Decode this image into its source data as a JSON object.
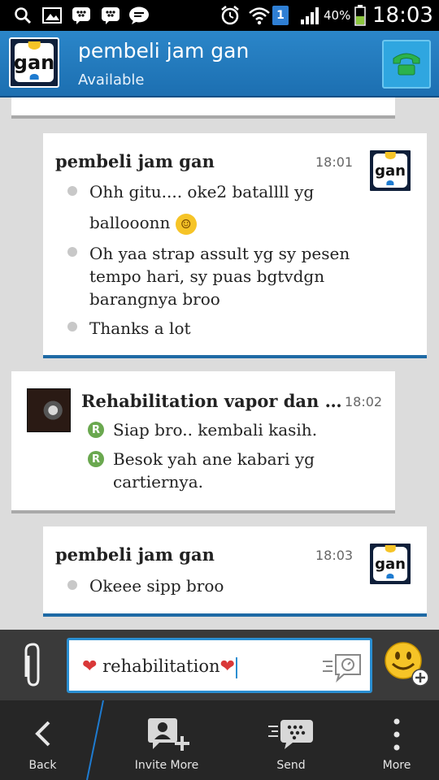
{
  "status_bar": {
    "battery_percent": "40%",
    "time": "18:03",
    "sim_badge": "1",
    "icons": [
      "search-icon",
      "gallery-icon",
      "bbm-icon",
      "bbm-icon",
      "chat-icon",
      "alarm-icon",
      "wifi-icon",
      "signal-icon",
      "battery-icon"
    ]
  },
  "header": {
    "avatar_text": "gan",
    "title": "pembeli jam gan",
    "status": "Available",
    "call_icon": "phone-icon"
  },
  "messages": [
    {
      "sender": "pembeli jam gan",
      "time": "18:01",
      "avatar_text": "gan",
      "lines": [
        {
          "text": "Ohh gitu.... oke2 batallll yg",
          "text2": "ballooonn",
          "emoji": "laughing-emoji"
        },
        {
          "text": "Oh yaa strap assult yg sy pesen tempo hari, sy puas bgtvdgn barangnya broo"
        },
        {
          "text": "Thanks a lot"
        }
      ]
    },
    {
      "sender": "Rehabilitation vapor dan j...",
      "time": "18:02",
      "read_mark": "R",
      "lines": [
        {
          "text": "Siap bro.. kembali kasih."
        },
        {
          "text": "Besok yah ane kabari yg cartiernya."
        }
      ]
    },
    {
      "sender": "pembeli jam gan",
      "time": "18:03",
      "avatar_text": "gan",
      "lines": [
        {
          "text": "Okeee sipp broo"
        }
      ]
    }
  ],
  "composer": {
    "value": "rehabilitation",
    "attach_icon": "paperclip-icon",
    "voice_icon": "voice-note-icon",
    "emoji_icon": "emoji-add-icon"
  },
  "bottom_bar": {
    "back_label": "Back",
    "invite_label": "Invite More",
    "send_label": "Send",
    "more_label": "More"
  },
  "colors": {
    "header_blue": "#1c6fb1",
    "mine_accent": "#1e6aa5",
    "read_green": "#6aa84f",
    "heart_red": "#d93838"
  }
}
